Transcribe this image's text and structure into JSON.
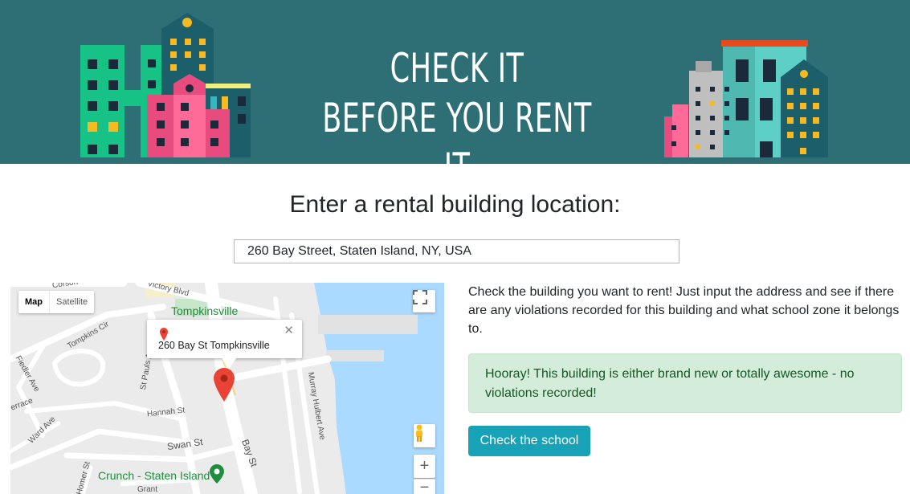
{
  "banner": {
    "title_line1": "CHECK IT",
    "title_line2": "BEFORE YOU RENT IT",
    "background_color": "#2e6e75"
  },
  "search": {
    "heading": "Enter a rental building location:",
    "value": "260 Bay Street, Staten Island, NY, USA"
  },
  "map": {
    "type_controls": {
      "map": "Map",
      "satellite": "Satellite",
      "selected": "Map"
    },
    "info_window": {
      "title": "260 Bay St Tompkinsville",
      "close_icon": "close-icon"
    },
    "labels": {
      "tompkinsville": "Tompkinsville",
      "crunch": "Crunch - Staten Island",
      "victory_blvd": "Victory Blvd",
      "bay_st": "Bay St",
      "swan_st": "Swan St",
      "hannah_st": "Hannah St",
      "murray_hulbert": "Murray Hulbert Ave",
      "st_pauls": "St Pauls Ave",
      "tompkins_cir": "Tompkins Cir",
      "fiedler_ave": "Fiedler Ave",
      "ward_ave": "Ward Ave",
      "corson": "Corson",
      "homer_st": "Homer St",
      "grant": "Grant",
      "terrace": "errace"
    },
    "zoom_in": "+",
    "zoom_out": "−",
    "marker_color": "#ea4335",
    "water_color": "#aadaff"
  },
  "info": {
    "description": "Check the building you want to rent! Just input the address and see if there are any violations recorded for this building and what school zone it belongs to.",
    "alert": "Hooray! This building is either brand new or totally awesome - no violations recorded!",
    "button": "Check the school"
  }
}
